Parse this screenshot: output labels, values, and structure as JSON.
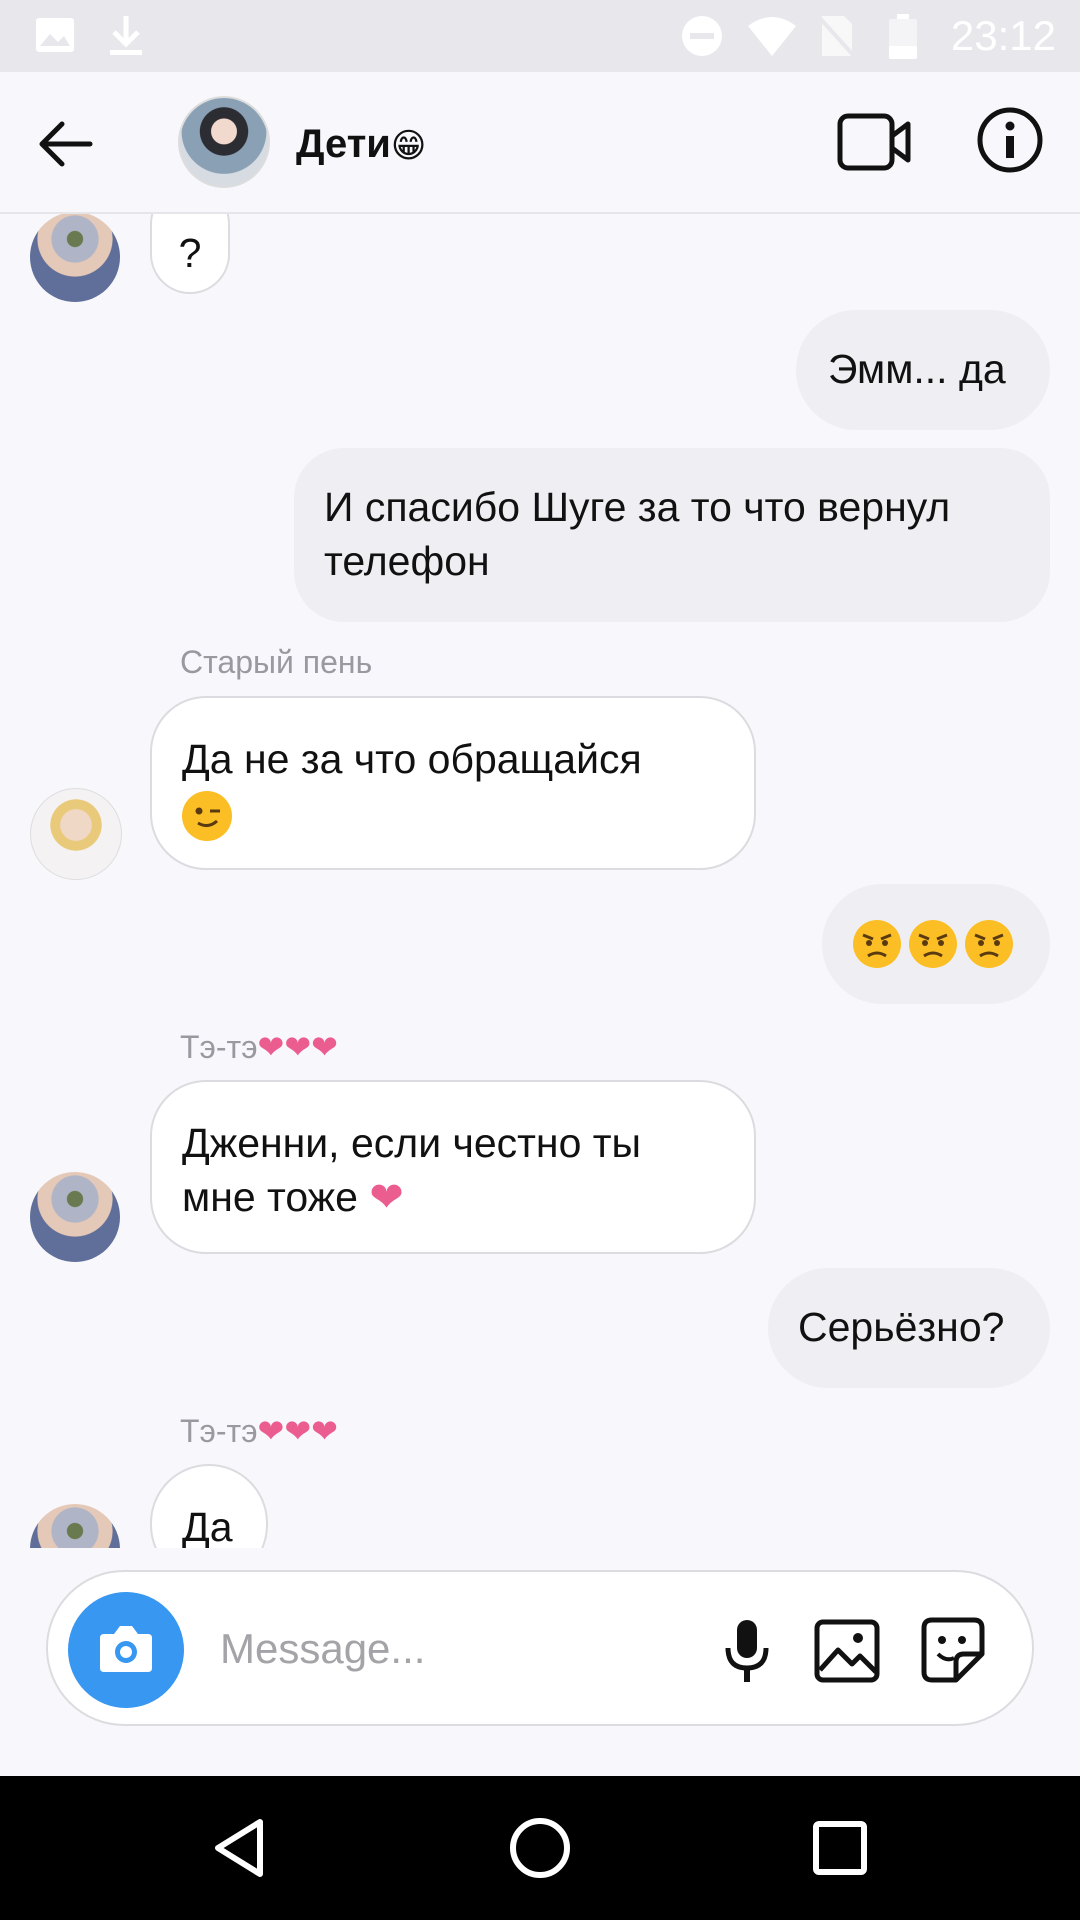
{
  "status_bar": {
    "time": "23:12",
    "icons": [
      "gallery-icon",
      "download-icon",
      "do-not-disturb-icon",
      "wifi-icon",
      "no-sim-icon",
      "battery-icon"
    ]
  },
  "header": {
    "title": "Дети",
    "title_emoji": "😁",
    "icons": [
      "back-arrow-icon",
      "video-call-icon",
      "info-icon"
    ]
  },
  "messages": [
    {
      "dir": "in",
      "avatar": "tae",
      "text": "?"
    },
    {
      "dir": "out",
      "text": "Эмм... да"
    },
    {
      "dir": "out",
      "text": "И спасибо Шуге за то что вернул телефон"
    },
    {
      "dir": "in",
      "sender": "Старый пень",
      "avatar": "suga",
      "text": "Да не за что обращайся",
      "emoji": "wink"
    },
    {
      "dir": "out",
      "emoji": "angry x3"
    },
    {
      "dir": "in",
      "sender": "Тэ-тэ",
      "sender_suffix": "❤❤❤",
      "avatar": "tae",
      "text": "Дженни, если честно ты мне тоже",
      "emoji_suffix": "❤"
    },
    {
      "dir": "out",
      "text": "Серьёзно?"
    },
    {
      "dir": "in",
      "sender": "Тэ-тэ",
      "sender_suffix": "❤❤❤",
      "avatar": "tae",
      "text": "Да"
    }
  ],
  "composer": {
    "placeholder": "Message...",
    "icons": [
      "camera-icon",
      "microphone-icon",
      "gallery-icon",
      "sticker-icon"
    ]
  },
  "colors": {
    "accent": "#3897f0",
    "heart": "#ec5d8f",
    "emoji": "#fbbe24"
  }
}
